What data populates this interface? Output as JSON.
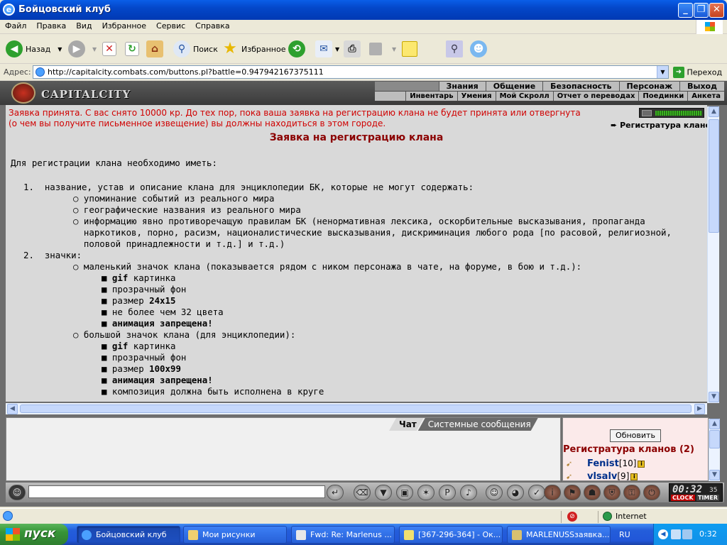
{
  "window": {
    "title": "Бойцовский клуб",
    "controls": [
      "minimize",
      "maximize",
      "close"
    ]
  },
  "menu": [
    "Файл",
    "Правка",
    "Вид",
    "Избранное",
    "Сервис",
    "Справка"
  ],
  "toolbar": {
    "back_label": "Назад",
    "search_label": "Поиск",
    "favorites_label": "Избранное"
  },
  "address": {
    "label": "Адрес:",
    "url": "http://capitalcity.combats.com/buttons.pl?battle=0.947942167375111",
    "go_label": "Переход"
  },
  "game": {
    "logo": "CAPITALCITY",
    "nav_top": [
      "Знания",
      "Общение",
      "Безопасность",
      "Персонаж",
      "Выход"
    ],
    "nav_bottom": [
      "Инвентарь",
      "Умения",
      "Мой Скролл",
      "Отчет о переводах",
      "Поединки",
      "Анкета"
    ],
    "notice_line1": "Заявка принята. С вас снято 10000 кр. До тех пор, пока ваша заявка на регистрацию клана не будет принята или отвергнута",
    "notice_line2": "(о чем вы получите письменное извещение) вы должны находиться в этом городе.",
    "side_link": "Регистратура кланов.",
    "heading": "Заявка на регистрацию клана",
    "intro": "Для регистрации клана необходимо иметь:",
    "items": {
      "item1_num": "1.",
      "item1": "название, устав и описание клана для энциклопедии БК, которые не могут содержать:",
      "item1_sub1": "упоминание событий из реального мира",
      "item1_sub2": "географические названия из реального мира",
      "item1_sub3_line1": "информацию явно противоречащую правилам БК (ненормативная лексика, оскорбительные высказывания, пропаганда",
      "item1_sub3_line2": "наркотиков, порно, расизм, националистические высказывания, дискриминация любого рода [по расовой, религиозной,",
      "item1_sub3_line3": "половой принадлежности и т.д.] и т.д.)",
      "item2_num": "2.",
      "item2": "значки:",
      "small_icon": "маленький значок клана (показывается рядом с ником персонажа в чате, на форуме, в бою и т.д.):",
      "small_gif_b": "gif",
      "small_gif": " картинка",
      "small_bg": "прозрачный фон",
      "small_size_lbl": "размер ",
      "small_size": "24x15",
      "small_colors": "не более чем 32 цвета",
      "small_anim": "анимация запрещена!",
      "big_icon": "большой значок клана (для энциклопедии):",
      "big_gif_b": "gif",
      "big_gif": " картинка",
      "big_bg": "прозрачный фон",
      "big_size_lbl": "размер ",
      "big_size": "100x99",
      "big_anim": "анимация запрещена!",
      "big_comp": "композиция должна быть исполнена в круге"
    }
  },
  "chat": {
    "tab_chat": "Чат",
    "tab_system": "Системные сообщения"
  },
  "list": {
    "refresh": "Обновить",
    "title": "Регистратура кланов (2)",
    "players": [
      {
        "name": "Fenist",
        "level": "[10]"
      },
      {
        "name": "vlsalv",
        "level": "[9]"
      }
    ]
  },
  "clock": {
    "time": "00:32",
    "seconds": "35",
    "clock_label": "CLOCK",
    "timer_label": "TIMER"
  },
  "status": {
    "zone": "Internet"
  },
  "taskbar": {
    "start": "пуск",
    "tasks": [
      "Бойцовский клуб",
      "Мои рисунки",
      "Fwd: Re: Marlenus ...",
      "[367-296-364] - Ок...",
      "MARLENUSSзаявка..."
    ],
    "lang": "RU",
    "time": "0:32"
  },
  "colors": {
    "notice": "#d00000",
    "heading": "#8b0000",
    "player_name": "#00308b"
  }
}
